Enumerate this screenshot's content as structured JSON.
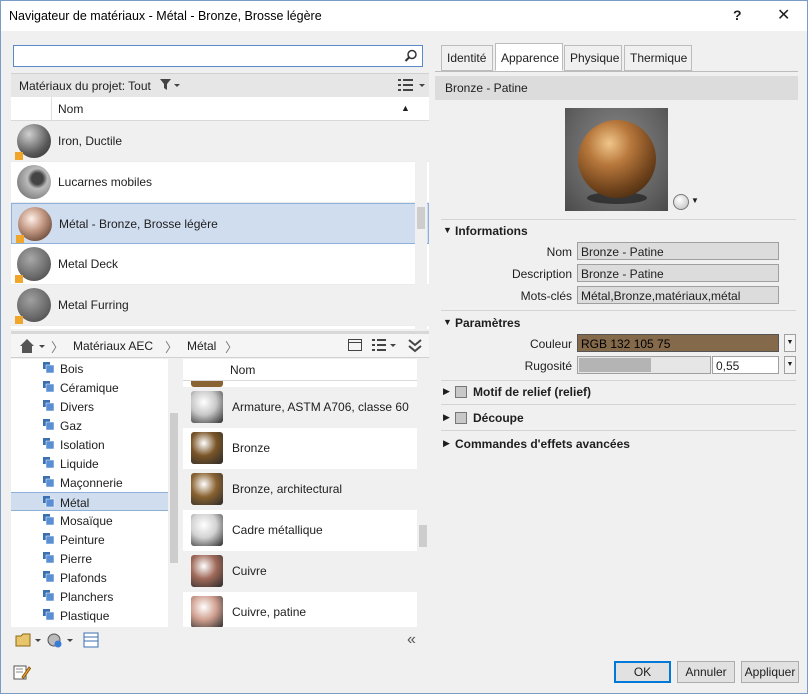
{
  "window": {
    "title": "Navigateur de matériaux - Métal - Bronze, Brosse légère",
    "help_label": "?",
    "close_label": "✕"
  },
  "search": {
    "value": "",
    "placeholder": ""
  },
  "filter_bar": {
    "label": "Matériaux du projet: Tout"
  },
  "project_list": {
    "column_header": "Nom",
    "items": [
      {
        "label": "Iron, Ductile",
        "thumb": "#6a6a6a"
      },
      {
        "label": "Lucarnes mobiles",
        "thumb": "#8c8c8c"
      },
      {
        "label": "Métal - Bronze, Brosse légère",
        "thumb": "#c9a08a"
      },
      {
        "label": "Metal Deck",
        "thumb": "#7c7c7c"
      },
      {
        "label": "Metal Furring",
        "thumb": "#767676"
      }
    ]
  },
  "breadcrumb": {
    "home_label": "Accueil",
    "items": [
      "Matériaux AEC",
      "Métal"
    ]
  },
  "categories": [
    "Bois",
    "Céramique",
    "Divers",
    "Gaz",
    "Isolation",
    "Liquide",
    "Maçonnerie",
    "Métal",
    "Mosaïque",
    "Peinture",
    "Pierre",
    "Plafonds",
    "Planchers",
    "Plastique"
  ],
  "selected_category": "Métal",
  "library_list": {
    "column_header": "Nom",
    "items": [
      {
        "label": "Armature, ASTM A706, classe 60",
        "thumb": "#c8c8c8"
      },
      {
        "label": "Bronze",
        "thumb": "#7a5528"
      },
      {
        "label": "Bronze, architectural",
        "thumb": "#8a6332"
      },
      {
        "label": "Cadre métallique",
        "thumb": "#d2d2d2"
      },
      {
        "label": "Cuivre",
        "thumb": "#a06a5a"
      },
      {
        "label": "Cuivre, patine",
        "thumb": "#d0a090"
      }
    ]
  },
  "tabs": [
    {
      "label": "Identité",
      "active": false
    },
    {
      "label": "Apparence",
      "active": true
    },
    {
      "label": "Physique",
      "active": false
    },
    {
      "label": "Thermique",
      "active": false
    }
  ],
  "asset": {
    "name": "Bronze - Patine"
  },
  "informations": {
    "header": "Informations",
    "name_label": "Nom",
    "name_value": "Bronze - Patine",
    "description_label": "Description",
    "description_value": "Bronze - Patine",
    "keywords_label": "Mots-clés",
    "keywords_value": "Métal,Bronze,matériaux,métal"
  },
  "parametres": {
    "header": "Paramètres",
    "color_label": "Couleur",
    "color_value": "RGB 132 105 75",
    "color_hex": "#84694b",
    "roughness_label": "Rugosité",
    "roughness_value": "0,55",
    "roughness_fraction": 0.55
  },
  "sections": {
    "relief": "Motif de relief (relief)",
    "cutout": "Découpe",
    "advanced": "Commandes d'effets avancées"
  },
  "buttons": {
    "ok": "OK",
    "cancel": "Annuler",
    "apply": "Appliquer"
  }
}
